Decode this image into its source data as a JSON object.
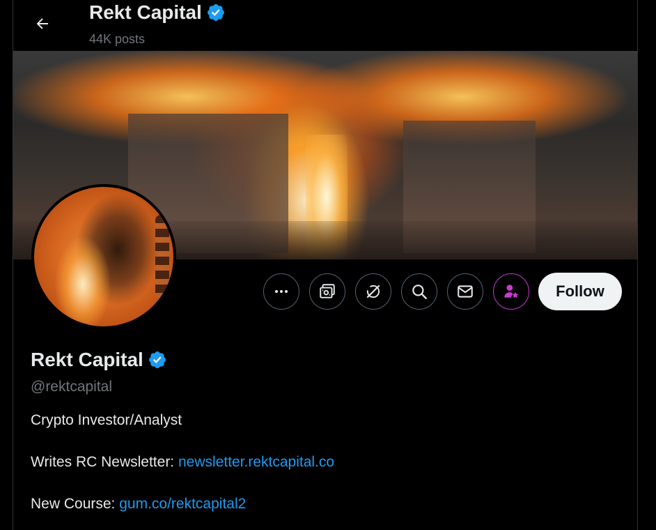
{
  "header": {
    "title": "Rekt Capital",
    "post_count": "44K posts"
  },
  "profile": {
    "name": "Rekt Capital",
    "handle": "@rektcapital",
    "verified_color": "#1d9bf0"
  },
  "actions": {
    "icons": [
      "more-icon",
      "subscribe-icon",
      "grok-icon",
      "search-icon",
      "message-icon",
      "person-star-icon"
    ],
    "follow_label": "Follow",
    "accent_purple": "#c93ad4"
  },
  "bio": {
    "line1": "Crypto Investor/Analyst",
    "line2_prefix": "Writes RC Newsletter: ",
    "line2_link": "newsletter.rektcapital.co",
    "line3_prefix": "New Course: ",
    "line3_link": "gum.co/rektcapital2",
    "link_color": "#1d9bf0"
  }
}
